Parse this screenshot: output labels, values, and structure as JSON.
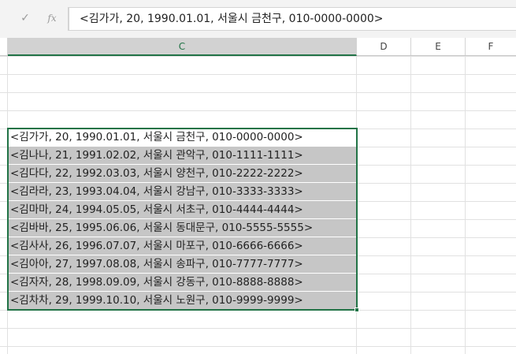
{
  "formula_bar": {
    "cancel_icon": "✓",
    "fx_label": "fx",
    "value": "<김가가, 20, 1990.01.01, 서울시 금천구, 010-0000-0000>"
  },
  "columns": [
    {
      "label": "C"
    },
    {
      "label": "D"
    },
    {
      "label": "E"
    },
    {
      "label": "F"
    }
  ],
  "cells": [
    "<김가가, 20, 1990.01.01, 서울시 금천구, 010-0000-0000>",
    "<김나나, 21, 1991.02.02, 서울시 관악구, 010-1111-1111>",
    "<김다다, 22, 1992.03.03, 서울시 양천구, 010-2222-2222>",
    "<김라라, 23, 1993.04.04, 서울시 강남구, 010-3333-3333>",
    "<김마마, 24, 1994.05.05, 서울시 서초구, 010-4444-4444>",
    "<김바바, 25, 1995.06.06, 서울시 동대문구, 010-5555-5555>",
    "<김사사, 26, 1996.07.07, 서울시 마포구, 010-6666-6666>",
    "<김아아, 27, 1997.08.08, 서울시 송파구, 010-7777-7777>",
    "<김자자, 28, 1998.09.09, 서울시 강동구, 010-8888-8888>",
    "<김차차, 29, 1999.10.10, 서울시 노원구, 010-9999-9999>"
  ],
  "colors": {
    "accent": "#217346",
    "selection": "#c6c6c6"
  }
}
